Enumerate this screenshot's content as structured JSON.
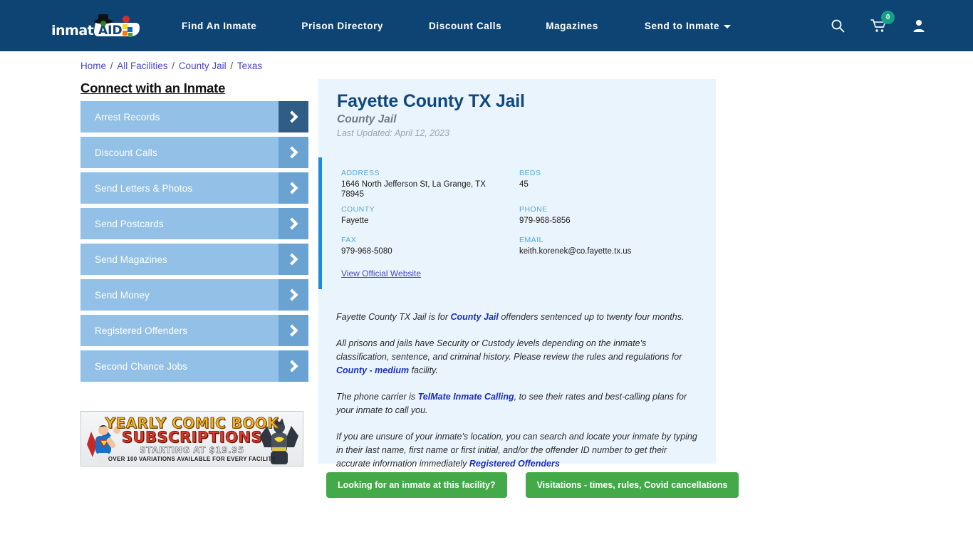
{
  "header": {
    "logo_text": "inmateAID",
    "nav": [
      {
        "label": "Find An Inmate"
      },
      {
        "label": "Prison Directory"
      },
      {
        "label": "Discount Calls"
      },
      {
        "label": "Magazines"
      },
      {
        "label": "Send to Inmate"
      }
    ],
    "icons": {
      "search": "search-icon",
      "cart": "cart-icon",
      "cart_count": "0",
      "account": "user-icon"
    },
    "colors": {
      "header_bg": "#0e4474",
      "cart_badge": "#16a085"
    }
  },
  "breadcrumb": {
    "items": [
      "Home",
      "All Facilities",
      "County Jail",
      "Texas"
    ],
    "separator": "/"
  },
  "sidebar": {
    "title": "Connect with an Inmate",
    "items": [
      {
        "label": "Arrest Records"
      },
      {
        "label": "Discount Calls"
      },
      {
        "label": "Send Letters & Photos"
      },
      {
        "label": "Send Postcards"
      },
      {
        "label": "Send Magazines"
      },
      {
        "label": "Send Money"
      },
      {
        "label": "Registered Offenders"
      },
      {
        "label": "Second Chance Jobs"
      }
    ]
  },
  "ad": {
    "line1": "YEARLY COMIC BOOK",
    "line2": "SUBSCRIPTIONS",
    "line3": "STARTING AT $19.95",
    "line4": "OVER 100 VARIATIONS AVAILABLE FOR EVERY FACILITY"
  },
  "facility": {
    "name": "Fayette County TX Jail",
    "type": "County Jail",
    "last_updated": "Last Updated: April 12, 2023",
    "fields": [
      {
        "label": "ADDRESS",
        "value": "1646 North Jefferson St, La Grange, TX 78945"
      },
      {
        "label": "BEDS",
        "value": "45"
      },
      {
        "label": "COUNTY",
        "value": "Fayette"
      },
      {
        "label": "PHONE",
        "value": "979-968-5856"
      },
      {
        "label": "FAX",
        "value": "979-968-5080"
      },
      {
        "label": "EMAIL",
        "value": "keith.korenek@co.fayette.tx.us"
      }
    ],
    "official_website_label": "View Official Website"
  },
  "description": {
    "p1_before": "Fayette County TX Jail is for ",
    "p1_link": "County Jail",
    "p1_after": " offenders sentenced up to twenty four months.",
    "p2_before": "All prisons and jails have Security or Custody levels depending on the inmate's classification, sentence, and criminal history. Please review the rules and regulations for ",
    "p2_link": "County - medium",
    "p2_after": " facility.",
    "p3_before": "The phone carrier is ",
    "p3_link": "TelMate Inmate Calling",
    "p3_after": ", to see their rates and best-calling plans for your inmate to call you.",
    "p4_before": "If you are unsure of your inmate's location, you can search and locate your inmate by typing in their last name, first name or first initial, and/or the offender ID number to get their accurate information immediately ",
    "p4_link": "Registered Offenders",
    "p4_after": ""
  },
  "buttons": {
    "inmate_lookup": "Looking for an inmate at this facility?",
    "visitations": "Visitations - times, rules, Covid cancellations",
    "color": "#44a948"
  }
}
